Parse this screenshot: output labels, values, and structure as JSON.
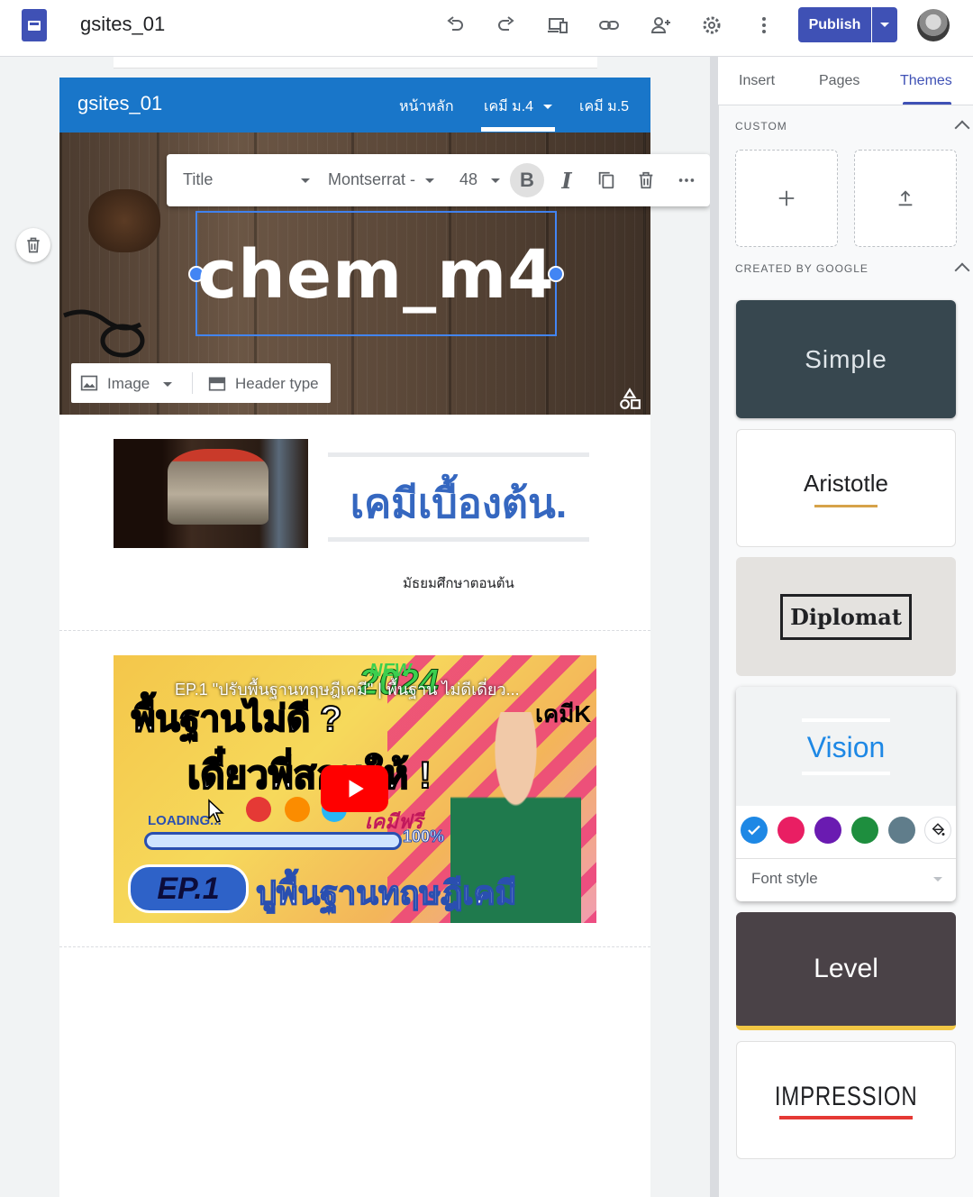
{
  "app": {
    "title": "gsites_01",
    "publish_label": "Publish"
  },
  "toolbar": {
    "icons": [
      "undo-icon",
      "redo-icon",
      "preview-devices-icon",
      "link-icon",
      "share-person-add-icon",
      "settings-gear-icon",
      "more-vert-icon"
    ]
  },
  "site": {
    "name": "gsites_01",
    "nav": [
      {
        "label": "หน้าหลัก",
        "active": false
      },
      {
        "label": "เคมี ม.4",
        "active": true
      },
      {
        "label": "เคมี ม.5",
        "active": false
      }
    ],
    "header_title": "chem_m4",
    "header_controls": {
      "image_label": "Image",
      "header_type_label": "Header type"
    }
  },
  "format_toolbar": {
    "style_value": "Title",
    "font_value": "Montserrat -",
    "size_value": "48",
    "bold_label": "B",
    "italic_label": "I"
  },
  "content": {
    "heading": "เคมีเบื้องต้น.",
    "subtext": "มัธยมศึกษาตอนต้น",
    "video": {
      "title": "EP.1 \"ปรับพื้นฐานทฤษฎีเคมี\" | พื้นฐาน ไม่ดีเดี่ยว...",
      "big_line1": "พื้นฐานไม่ดี ?",
      "big_line2": "เดี๋ยวพี่สอนให้ !",
      "year": "2024",
      "badge_new": "NEW",
      "brand": "เคมีK",
      "loading": "LOADING...",
      "free_label": "เคมีฟรี",
      "percent": "100%",
      "ep_badge": "EP.1",
      "ep_title": "ปูพื้นฐานทฤษฎีเคมี"
    }
  },
  "panel": {
    "tabs": [
      {
        "label": "Insert",
        "active": false
      },
      {
        "label": "Pages",
        "active": false
      },
      {
        "label": "Themes",
        "active": true
      }
    ],
    "custom_label": "CUSTOM",
    "created_label": "CREATED BY GOOGLE",
    "themes": [
      {
        "name": "Simple",
        "bg": "#37474f",
        "fg": "#e0e6ea"
      },
      {
        "name": "Aristotle",
        "bg": "#ffffff",
        "fg": "#202124",
        "accent": "#d6a24a"
      },
      {
        "name": "Diplomat",
        "bg": "#e4e2df",
        "fg": "#202124"
      },
      {
        "name": "Vision",
        "bg": "#f1f3f4",
        "fg": "#1e88e5"
      },
      {
        "name": "Level",
        "bg": "#4a4247",
        "fg": "#ffffff",
        "accent": "#f2c744"
      },
      {
        "name": "IMPRESSION",
        "bg": "#ffffff",
        "fg": "#202124",
        "accent": "#e53935"
      }
    ],
    "vision_colors": [
      "#1e88e5",
      "#e91e63",
      "#6a1bb1",
      "#1e8e3e",
      "#607d8b"
    ],
    "font_style_label": "Font style"
  }
}
